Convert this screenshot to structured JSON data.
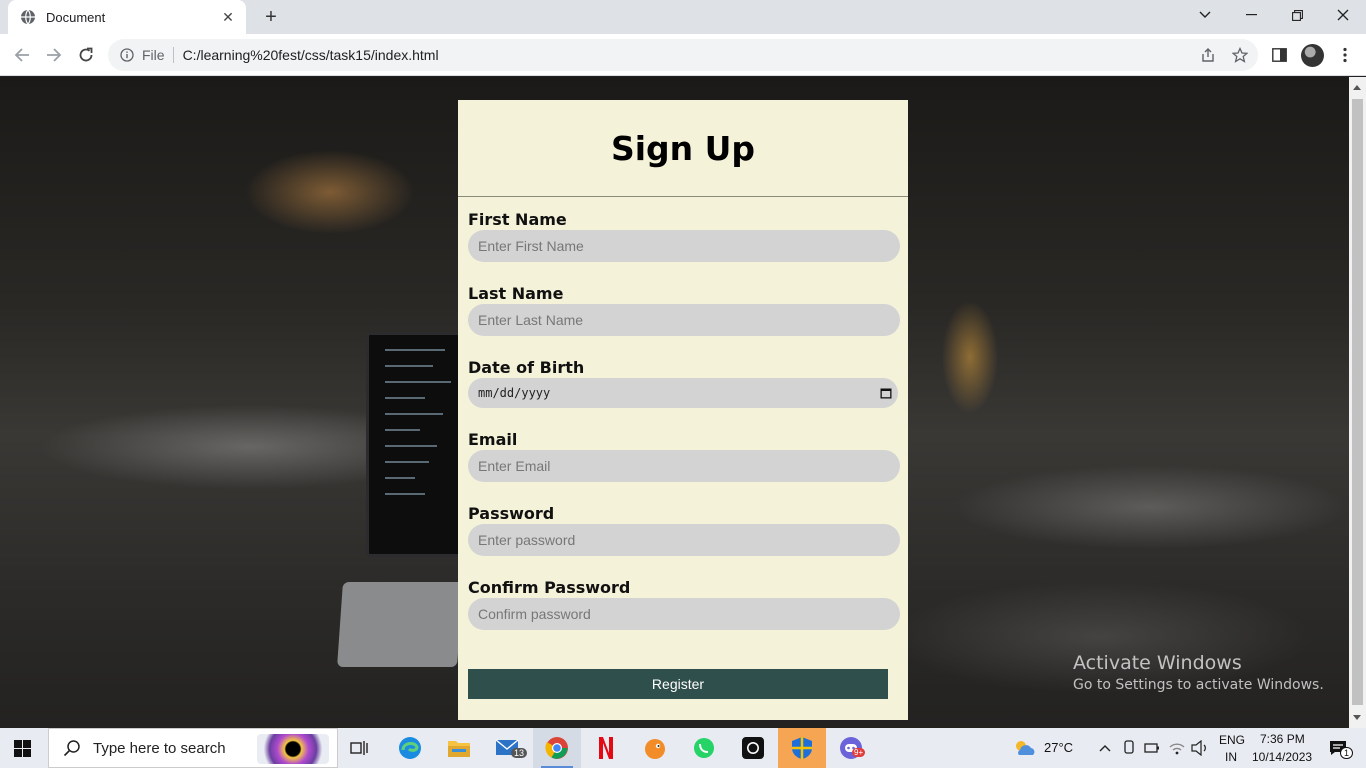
{
  "browser": {
    "tab_title": "Document",
    "tab_close": "✕",
    "new_tab": "+",
    "omnibox_label": "File",
    "url": "C:/learning%20fest/css/task15/index.html"
  },
  "page": {
    "title": "Sign Up",
    "fields": [
      {
        "label": "First Name",
        "placeholder": "Enter First Name"
      },
      {
        "label": "Last Name",
        "placeholder": "Enter Last Name"
      },
      {
        "label": "Date of Birth",
        "placeholder": "mm/dd/yyyy"
      },
      {
        "label": "Email",
        "placeholder": "Enter Email"
      },
      {
        "label": "Password",
        "placeholder": "Enter password"
      },
      {
        "label": "Confirm Password",
        "placeholder": "Confirm password"
      }
    ],
    "register_label": "Register"
  },
  "watermark": {
    "title": "Activate Windows",
    "subtitle": "Go to Settings to activate Windows."
  },
  "taskbar": {
    "search_placeholder": "Type here to search",
    "mail_badge": "13",
    "discord_badge": "9+",
    "weather": "27°C",
    "language": "ENG",
    "region": "IN",
    "time": "7:36 PM",
    "date": "10/14/2023",
    "notification_count": "1"
  },
  "colors": {
    "card_bg": "#f4f2d9",
    "input_bg": "#d3d3d3",
    "register_bg": "#2f4f4c"
  }
}
